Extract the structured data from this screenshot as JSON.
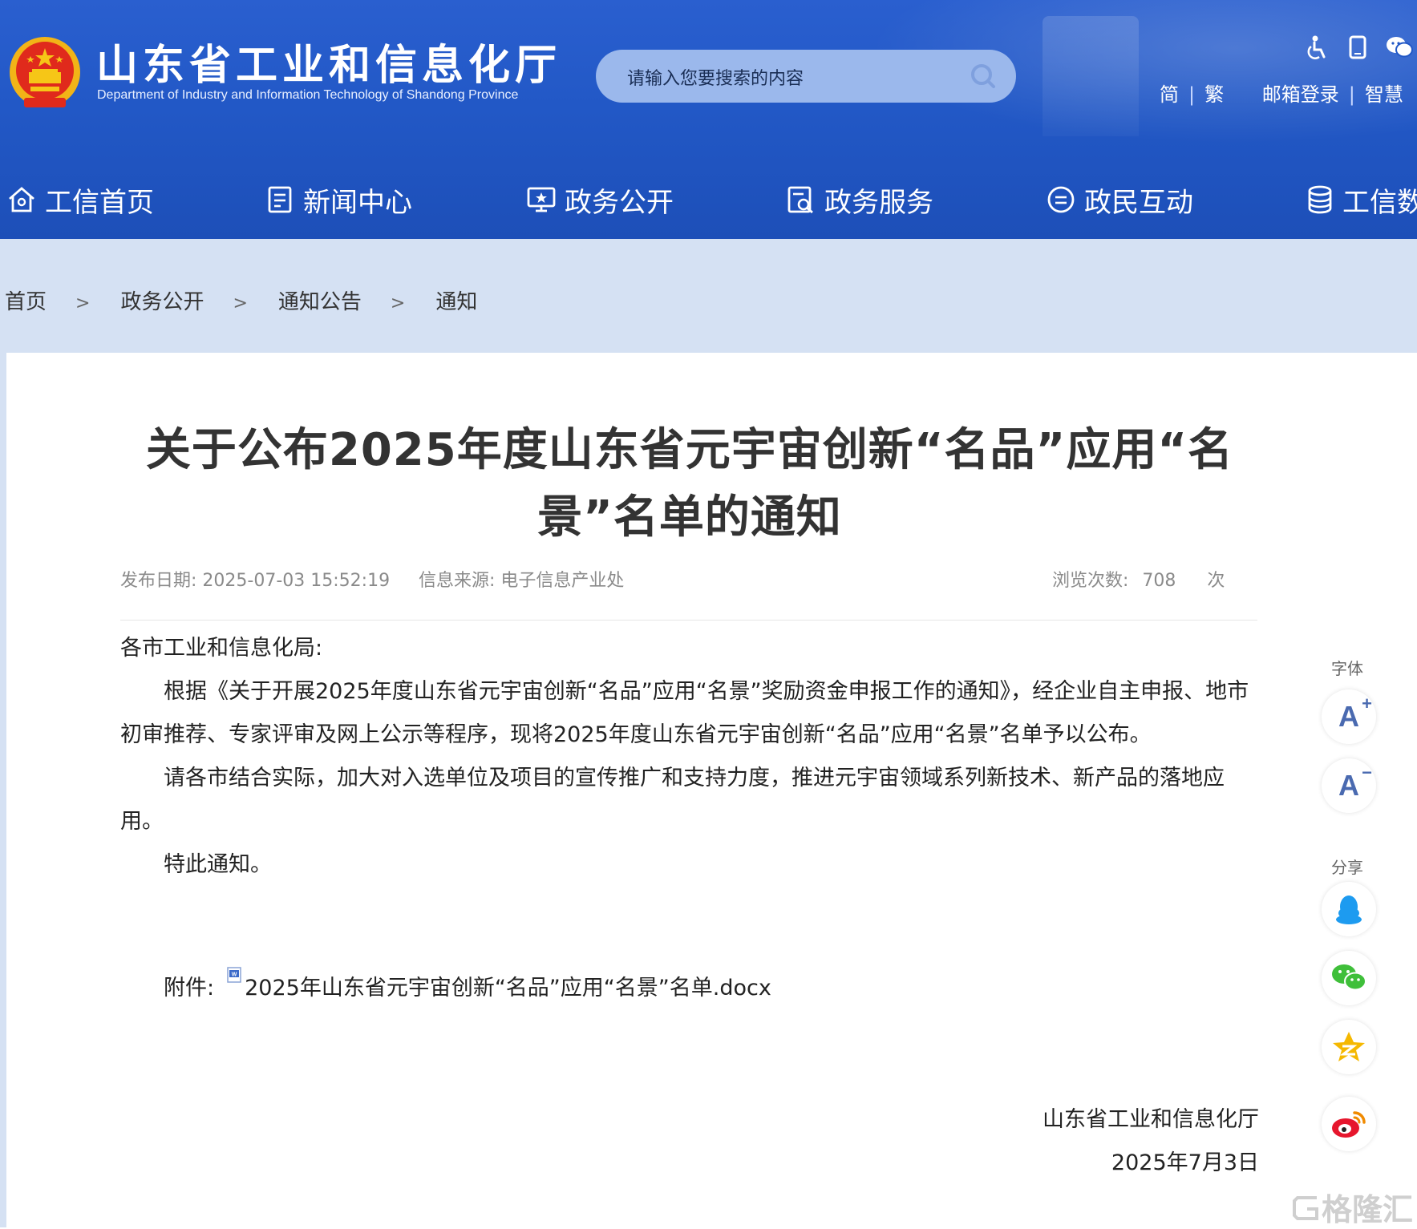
{
  "header": {
    "site_title": "山东省工业和信息化厅",
    "site_subtitle": "Department of Industry and Information Technology of Shandong Province",
    "search_placeholder": "请输入您要搜索的内容",
    "util": {
      "simplified": "简",
      "traditional": "繁",
      "mail_login": "邮箱登录",
      "smart": "智慧"
    }
  },
  "nav": {
    "items": [
      {
        "label": "工信首页",
        "icon": "home-icon"
      },
      {
        "label": "新闻中心",
        "icon": "news-icon"
      },
      {
        "label": "政务公开",
        "icon": "monitor-icon"
      },
      {
        "label": "政务服务",
        "icon": "service-icon"
      },
      {
        "label": "政民互动",
        "icon": "chat-icon"
      },
      {
        "label": "工信数",
        "icon": "database-icon"
      }
    ]
  },
  "breadcrumb": {
    "items": [
      "首页",
      "政务公开",
      "通知公告",
      "通知"
    ],
    "separator": ">"
  },
  "article": {
    "title": "关于公布2025年度山东省元宇宙创新“名品”应用“名景”名单的通知",
    "meta": {
      "date_label": "发布日期:",
      "date_value": "2025-07-03 15:52:19",
      "source_label": "信息来源:",
      "source_value": "电子信息产业处",
      "views_label": "浏览次数:",
      "views_value": "708",
      "views_unit": "次"
    },
    "salutation": "各市工业和信息化局:",
    "paragraphs": [
      "根据《关于开展2025年度山东省元宇宙创新“名品”应用“名景”奖励资金申报工作的通知》，经企业自主申报、地市初审推荐、专家评审及网上公示等程序，现将2025年度山东省元宇宙创新“名品”应用“名景”名单予以公布。",
      "请各市结合实际，加大对入选单位及项目的宣传推广和支持力度，推进元宇宙领域系列新技术、新产品的落地应用。",
      "特此通知。"
    ],
    "attachment_label": "附件:",
    "attachment_file": "2025年山东省元宇宙创新“名品”应用“名景”名单.docx",
    "signature_org": "山东省工业和信息化厅",
    "signature_date": "2025年7月3日"
  },
  "sidebar": {
    "font_label": "字体",
    "font_increase": "A",
    "font_decrease": "A",
    "share_label": "分享"
  },
  "watermark": "格隆汇"
}
